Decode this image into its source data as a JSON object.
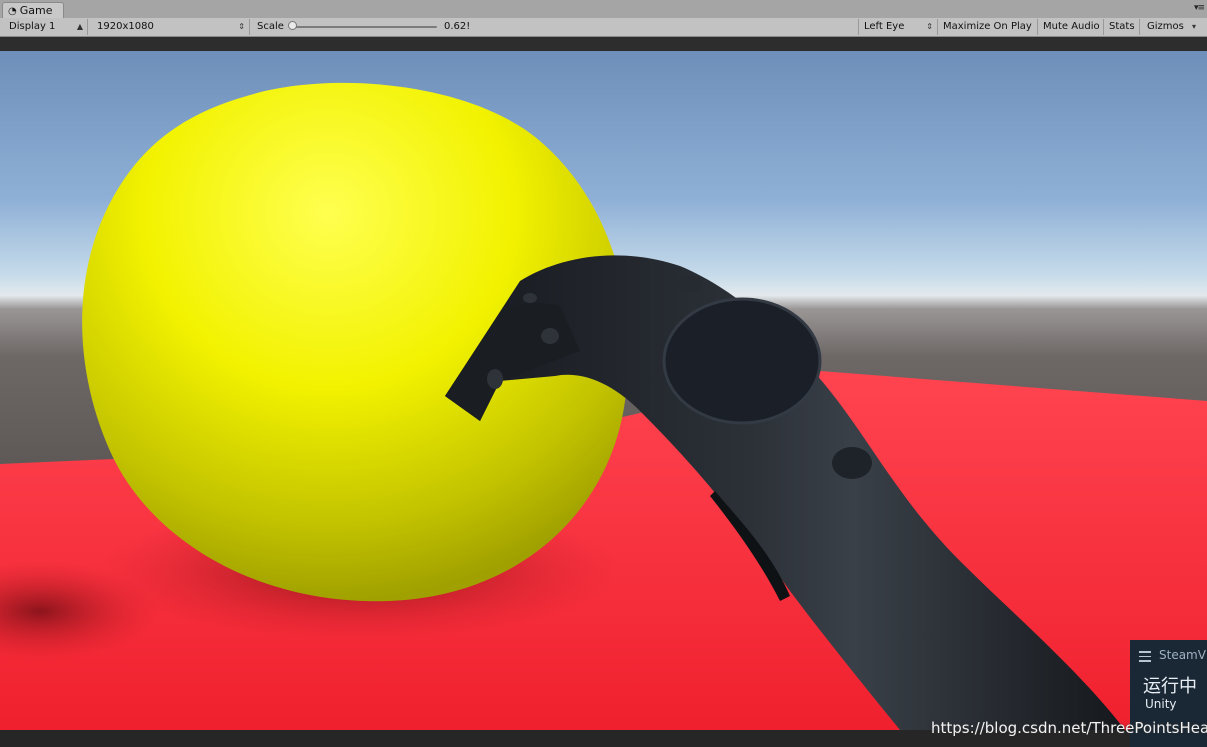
{
  "tabs": [
    {
      "label": "Game",
      "icon": "pacman-game-icon"
    }
  ],
  "toolbar": {
    "display": "Display 1",
    "resolution": "1920x1080",
    "scale_label": "Scale",
    "scale_value": "0.62!",
    "scale_fraction": 0.0,
    "eye": "Left Eye",
    "maximize": "Maximize On Play",
    "mute": "Mute Audio",
    "stats": "Stats",
    "gizmos": "Gizmos"
  },
  "steamvr": {
    "title": "SteamVR",
    "status": "运行中",
    "app": "Unity"
  },
  "watermark": "https://blog.csdn.net/ThreePointsHeat",
  "colors": {
    "sphere": "#ffff00",
    "floor": "#ff3b45",
    "controller": "#23272d",
    "sky": "#8fb0d6"
  }
}
